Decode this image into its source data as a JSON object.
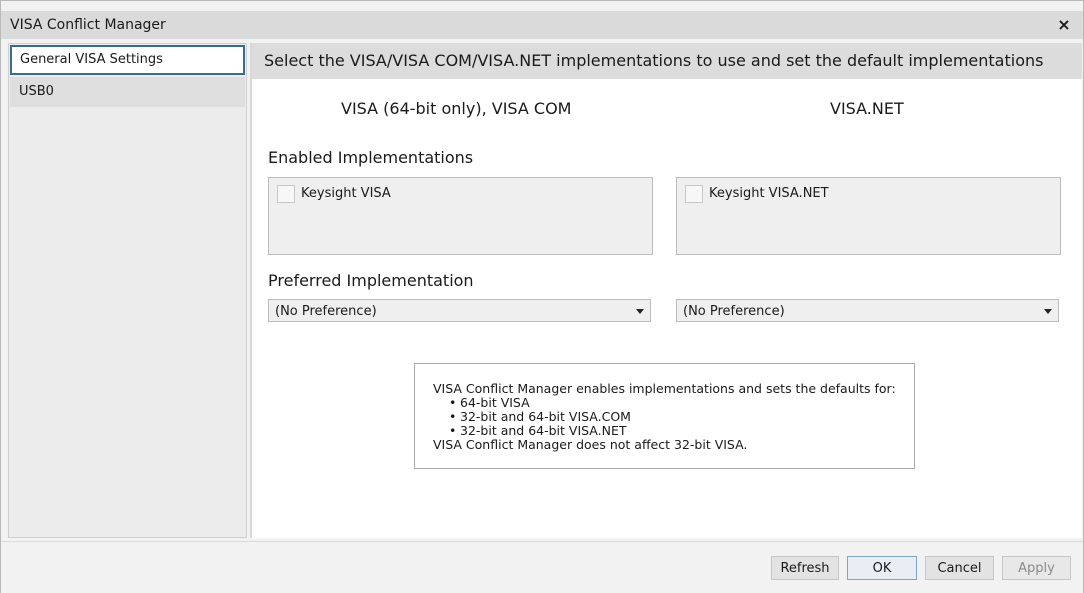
{
  "window": {
    "title": "VISA Conflict Manager",
    "close_icon": "×"
  },
  "sidebar": {
    "items": [
      {
        "label": "General VISA Settings",
        "selected": true
      },
      {
        "label": "USB0",
        "selected": false
      }
    ]
  },
  "main": {
    "header": "Select the VISA/VISA COM/VISA.NET implementations to use and set the default implementations",
    "columns": [
      {
        "title": "VISA (64-bit only), VISA COM",
        "checkbox_label": "Keysight VISA",
        "checked": false,
        "preference": "(No Preference)"
      },
      {
        "title": "VISA.NET",
        "checkbox_label": "Keysight VISA.NET",
        "checked": false,
        "preference": "(No Preference)"
      }
    ],
    "enabled_title": "Enabled Implementations",
    "preferred_title": "Preferred Implementation",
    "info": {
      "line1": "VISA Conflict Manager enables implementations and sets the defaults for:",
      "bullets": [
        "64-bit VISA",
        "32-bit and 64-bit VISA.COM",
        "32-bit and 64-bit VISA.NET"
      ],
      "line2": "VISA Conflict Manager does not affect 32-bit VISA."
    }
  },
  "footer": {
    "refresh": "Refresh",
    "ok": "OK",
    "cancel": "Cancel",
    "apply": "Apply"
  }
}
